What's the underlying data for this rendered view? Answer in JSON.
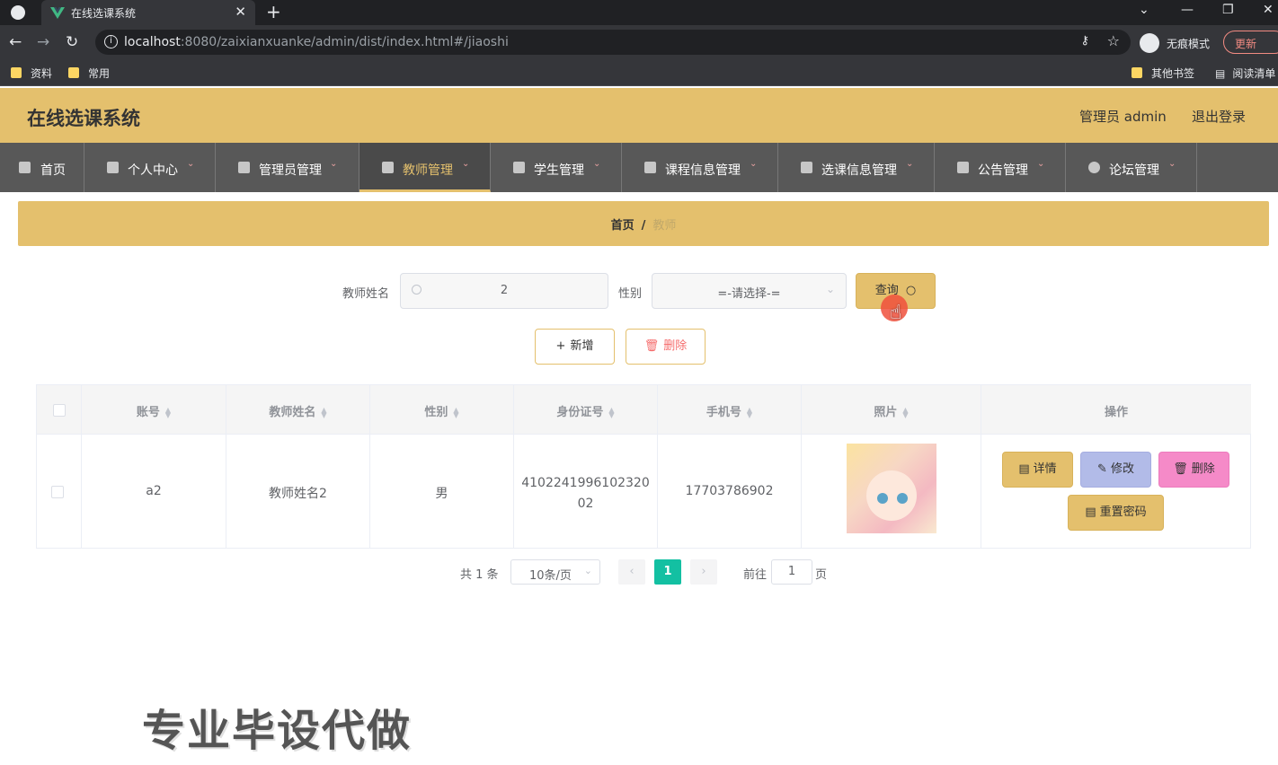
{
  "browser": {
    "tab_title": "在线选课系统",
    "url_host": "localhost",
    "url_rest": ":8080/zaixianxuanke/admin/dist/index.html#/jiaoshi",
    "incognito_label": "无痕模式",
    "update_label": "更新",
    "bookmarks": [
      "资料",
      "常用",
      "其他书签",
      "阅读清单"
    ]
  },
  "header": {
    "title": "在线选课系统",
    "user": "管理员 admin",
    "logout": "退出登录"
  },
  "nav": {
    "items": [
      {
        "label": "首页",
        "icon": "home-icon"
      },
      {
        "label": "个人中心",
        "icon": "user-icon"
      },
      {
        "label": "管理员管理",
        "icon": "briefcase-icon"
      },
      {
        "label": "教师管理",
        "icon": "clipboard-icon"
      },
      {
        "label": "学生管理",
        "icon": "copy-icon"
      },
      {
        "label": "课程信息管理",
        "icon": "crop-icon"
      },
      {
        "label": "选课信息管理",
        "icon": "books-icon"
      },
      {
        "label": "公告管理",
        "icon": "notice-icon"
      },
      {
        "label": "论坛管理",
        "icon": "forum-icon"
      }
    ],
    "active_color": "#e4c06d"
  },
  "breadcrumb": {
    "home": "首页",
    "separator": "/",
    "current": "教师"
  },
  "search": {
    "name_label": "教师姓名",
    "name_value": "2",
    "gender_label": "性别",
    "gender_value": "=-请选择-=",
    "query_label": "查询"
  },
  "actions": {
    "add_label": "新增",
    "delete_label": "删除"
  },
  "table": {
    "headers": [
      "账号",
      "教师姓名",
      "性别",
      "身份证号",
      "手机号",
      "照片",
      "操作"
    ],
    "rows": [
      {
        "account": "a2",
        "name": "教师姓名2",
        "gender": "男",
        "id_line1": "4102241996102320",
        "id_line2": "02",
        "phone": "17703786902"
      }
    ],
    "row_actions": {
      "detail": "详情",
      "edit": "修改",
      "delete": "删除",
      "reset": "重置密码"
    }
  },
  "pagination": {
    "total_text": "共 1 条",
    "page_size": "10条/页",
    "current_page": "1",
    "goto_label": "前往",
    "goto_value": "1",
    "page_suffix": "页"
  },
  "watermark": "专业毕设代做",
  "colors": {
    "accent": "#e4c06d",
    "nav_bg": "#585858",
    "pager_active": "#13c0a2",
    "edit_btn": "#b2bbe8",
    "delete_btn": "#f58ac8"
  }
}
